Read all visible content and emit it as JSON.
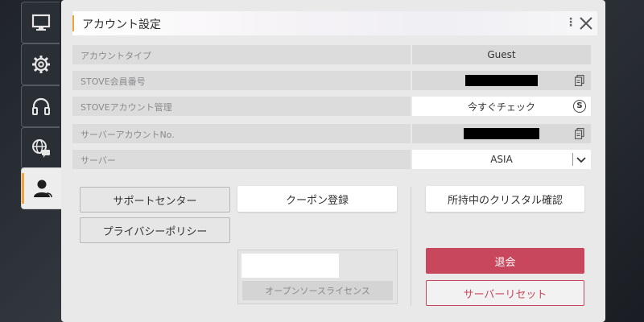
{
  "panel": {
    "title": "アカウント設定",
    "more_glyph": "⋮"
  },
  "tabs": [
    {
      "icon": "monitor-icon",
      "active": false
    },
    {
      "icon": "gear-icon",
      "active": false
    },
    {
      "icon": "headset-icon",
      "active": false
    },
    {
      "icon": "globe-chat-icon",
      "active": false
    },
    {
      "icon": "user-icon",
      "active": true
    }
  ],
  "rows": [
    {
      "label": "アカウントタイプ",
      "value": "Guest"
    },
    {
      "label": "STOVE会員番号",
      "value": ""
    },
    {
      "label": "STOVEアカウント管理",
      "value": "今すぐチェック",
      "badge": "S"
    },
    {
      "label": "サーバーアカウントNo.",
      "value": ""
    },
    {
      "label": "サーバー",
      "value": "ASIA"
    }
  ],
  "buttons": {
    "support": "サポートセンター",
    "privacy": "プライバシーポリシー",
    "coupon": "クーポン登録",
    "crystal": "所持中のクリスタル確認",
    "open_source": "オープンソースライセンス",
    "withdraw": "退会",
    "server_reset": "サーバーリセット"
  },
  "colors": {
    "accent": "#f0a23a",
    "danger": "#c9475c"
  }
}
